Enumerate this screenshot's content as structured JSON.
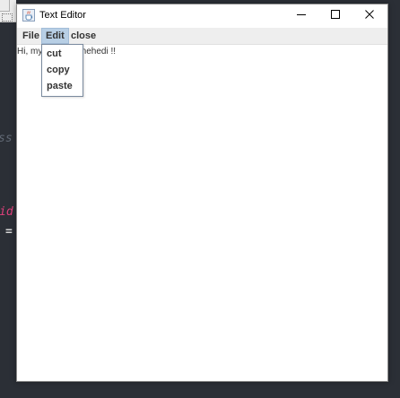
{
  "window": {
    "title": "Text Editor",
    "app_icon": "java-cup-icon",
    "controls": {
      "minimize_icon": "minimize-icon",
      "maximize_icon": "maximize-icon",
      "close_icon": "close-icon"
    }
  },
  "menubar": {
    "items": [
      {
        "label": "File"
      },
      {
        "label": "Edit",
        "open": true
      },
      {
        "label": "close"
      }
    ]
  },
  "edit_menu": {
    "items": [
      {
        "label": "cut"
      },
      {
        "label": "copy"
      },
      {
        "label": "paste"
      }
    ]
  },
  "editor": {
    "text": "Hi, my name is mehedi !!"
  },
  "background": {
    "code_fragment_1": "ss",
    "code_fragment_2": "id",
    "code_fragment_3": "="
  },
  "colors": {
    "menu_selected": "#b8cfe5",
    "background_ide": "#2b2f36",
    "keyword_pink": "#e0407c"
  }
}
